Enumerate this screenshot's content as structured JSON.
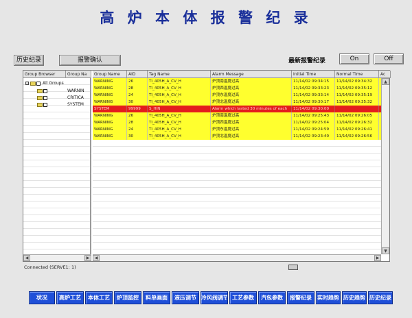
{
  "title": "高 炉 本 体 报 警 纪 录",
  "toolbar": {
    "history_label": "历史纪录",
    "ack_label": "报警确认",
    "latest_label": "最新报警纪录",
    "on_label": "On",
    "off_label": "Off"
  },
  "tree": {
    "headers": [
      "Group Browser",
      "Group Na"
    ],
    "root": "All Groups",
    "children": [
      "WARNIN",
      "CRITICA",
      "SYSTEM"
    ]
  },
  "table": {
    "headers": [
      "Group Name",
      "AID",
      "Tag Name",
      "Alarm Message",
      "Initial Time",
      "Normal Time",
      "Ac"
    ],
    "rows": [
      {
        "type": "warning",
        "group": "WARNING",
        "aid": "26",
        "tag": "TI_405H_A_CV_H",
        "msg": "炉顶南温度过高",
        "initial": "11/14/02 09:34:15",
        "normal": "11/14/02 09:34:32"
      },
      {
        "type": "warning",
        "group": "WARNING",
        "aid": "28",
        "tag": "TI_405H_A_CV_H",
        "msg": "炉顶西温度过高",
        "initial": "11/14/02 09:33:23",
        "normal": "11/14/02 09:35:12"
      },
      {
        "type": "warning",
        "group": "WARNING",
        "aid": "24",
        "tag": "TI_405H_A_CV_H",
        "msg": "炉顶东温度过高",
        "initial": "11/14/02 09:33:14",
        "normal": "11/14/02 09:35:19"
      },
      {
        "type": "warning",
        "group": "WARNING",
        "aid": "30",
        "tag": "TI_405H_A_CV_H",
        "msg": "炉顶北温度过高",
        "initial": "11/14/02 09:30:17",
        "normal": "11/14/02 09:35:32"
      },
      {
        "type": "system",
        "group": "SYSTEM",
        "aid": "99999",
        "tag": "S_HIN",
        "msg": "Alarm which lasted 30 minutes of each",
        "initial": "11/14/02 09:30:00",
        "normal": ""
      },
      {
        "type": "warning",
        "group": "WARNING",
        "aid": "26",
        "tag": "TI_405H_A_CV_H",
        "msg": "炉顶南温度过高",
        "initial": "11/14/02 09:25:43",
        "normal": "11/14/02 09:26:05"
      },
      {
        "type": "warning",
        "group": "WARNING",
        "aid": "28",
        "tag": "TI_405H_A_CV_H",
        "msg": "炉顶西温度过高",
        "initial": "11/14/02 09:25:04",
        "normal": "11/14/02 09:26:32"
      },
      {
        "type": "warning",
        "group": "WARNING",
        "aid": "24",
        "tag": "TI_405H_A_CV_H",
        "msg": "炉顶东温度过高",
        "initial": "11/14/02 09:24:59",
        "normal": "11/14/02 09:26:41"
      },
      {
        "type": "warning",
        "group": "WARNING",
        "aid": "30",
        "tag": "TI_405H_A_CV_H",
        "msg": "炉顶北温度过高",
        "initial": "11/14/02 09:23:40",
        "normal": "11/14/02 09:26:56"
      }
    ]
  },
  "status_text": "Connected (SERVE1: 1)",
  "nav": [
    "状况",
    "高炉工艺",
    "本体工艺",
    "炉顶监控",
    "料单画面",
    "液压调节",
    "冷风阀调节",
    "工艺参数",
    "汽包参数",
    "报警纪录",
    "实时趋势",
    "历史趋势",
    "历史纪录"
  ],
  "colors": {
    "title": "#1a2f9a",
    "warning_row": "#ffff2e",
    "system_row": "#e41d1d",
    "nav_bg": "#1f4fd8"
  }
}
